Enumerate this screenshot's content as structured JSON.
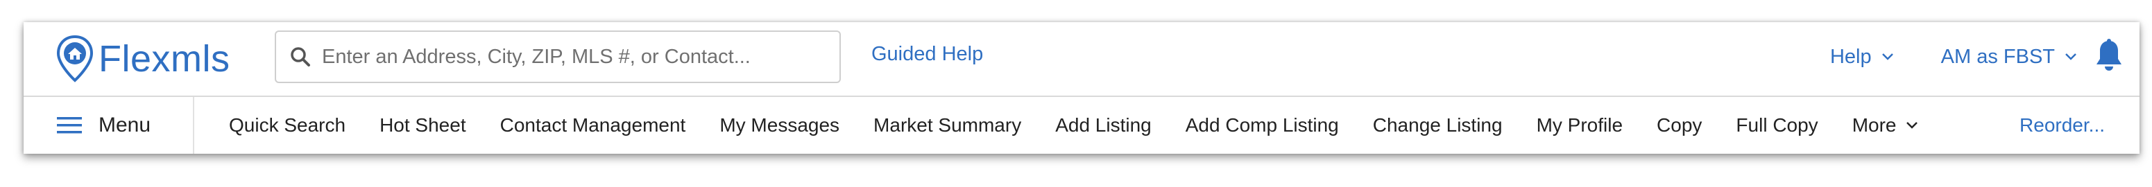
{
  "brand": {
    "name": "Flexmls",
    "color": "#2f6fc2"
  },
  "search": {
    "placeholder": "Enter an Address, City, ZIP, MLS #, or Contact...",
    "value": ""
  },
  "header": {
    "guided_help": "Guided Help",
    "help_label": "Help",
    "user_label": "AM as FBST"
  },
  "menu": {
    "label": "Menu"
  },
  "nav": {
    "items": [
      "Quick Search",
      "Hot Sheet",
      "Contact Management",
      "My Messages",
      "Market Summary",
      "Add Listing",
      "Add Comp Listing",
      "Change Listing",
      "My Profile",
      "Copy",
      "Full Copy"
    ],
    "more_label": "More",
    "reorder_label": "Reorder..."
  },
  "icons": {
    "logo": "house-pin-icon",
    "search": "search-icon",
    "chevron": "chevron-down-icon",
    "bell": "bell-icon",
    "menu": "hamburger-icon"
  }
}
